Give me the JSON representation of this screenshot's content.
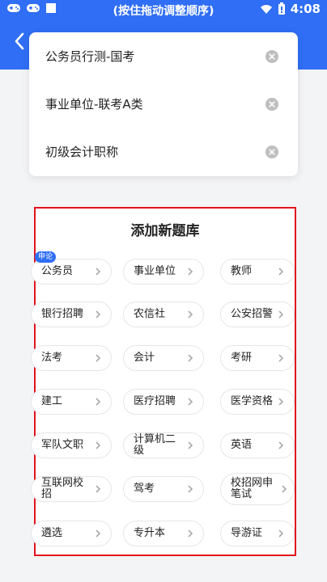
{
  "status_bar": {
    "hint": "(按住拖动调整顺序)",
    "time": "4:08",
    "icons": [
      "gamepad-icon",
      "gamepad-icon",
      "square-icon",
      "wifi-icon",
      "battery-icon"
    ]
  },
  "header": {
    "back_icon": "chevron-left-icon"
  },
  "selected_banks": [
    {
      "label": "公务员行测-国考"
    },
    {
      "label": "事业单位-联考A类"
    },
    {
      "label": "初级会计职称"
    }
  ],
  "add_section": {
    "title": "添加新题库",
    "items": [
      {
        "label": "公务员",
        "badge": "申论"
      },
      {
        "label": "事业单位"
      },
      {
        "label": "教师"
      },
      {
        "label": "银行招聘"
      },
      {
        "label": "农信社"
      },
      {
        "label": "公安招警"
      },
      {
        "label": "法考"
      },
      {
        "label": "会计"
      },
      {
        "label": "考研"
      },
      {
        "label": "建工"
      },
      {
        "label": "医疗招聘"
      },
      {
        "label": "医学资格"
      },
      {
        "label": "军队文职"
      },
      {
        "label": "计算机二级"
      },
      {
        "label": "英语"
      },
      {
        "label": "互联网校招"
      },
      {
        "label": "驾考"
      },
      {
        "label": "校招网申笔试"
      },
      {
        "label": "遴选"
      },
      {
        "label": "专升本"
      },
      {
        "label": "导游证"
      }
    ]
  },
  "colors": {
    "brand": "#2f6ef5",
    "highlight_border": "#e0141e"
  }
}
